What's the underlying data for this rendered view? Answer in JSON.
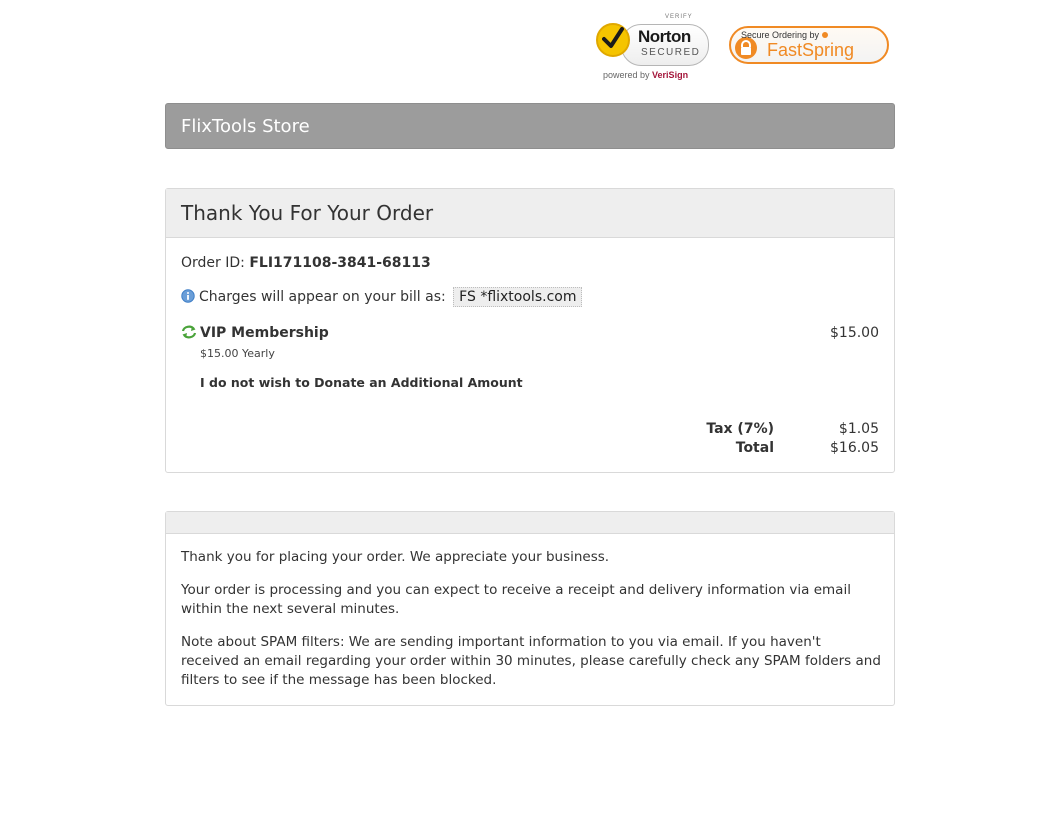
{
  "badges": {
    "norton": {
      "verify": "VERIFY",
      "brand": "Norton",
      "secured": "SECURED",
      "powered_prefix": "powered by",
      "powered_brand": "VeriSign"
    },
    "fastspring": {
      "line1": "Secure Ordering by",
      "line2": "FastSpring"
    }
  },
  "store": {
    "title": "FlixTools Store"
  },
  "order": {
    "heading": "Thank You For Your Order",
    "order_id_label": "Order ID:",
    "order_id": "FLI171108-3841-68113",
    "bill_label": "Charges will appear on your bill as:",
    "bill_descriptor": "FS *flixtools.com",
    "item": {
      "name": "VIP Membership",
      "subscription": "$15.00 Yearly",
      "price": "$15.00",
      "option": "I do not wish to Donate an Additional Amount"
    },
    "tax_label": "Tax (7%)",
    "tax": "$1.05",
    "total_label": "Total",
    "total": "$16.05"
  },
  "message": {
    "p1": "Thank you for placing your order. We appreciate your business.",
    "p2": "Your order is processing and you can expect to receive a receipt and delivery information via email within the next several minutes.",
    "p3": "Note about SPAM filters: We are sending important information to you via email. If you haven't received an email regarding your order within 30 minutes, please carefully check any SPAM folders and filters to see if the message has been blocked."
  },
  "colors": {
    "store_bar": "#9c9c9c",
    "panel_head": "#eeeeee",
    "fastspring_orange": "#f08a24",
    "norton_yellow": "#f5c400",
    "info_blue": "#3f7fc7",
    "renew_green": "#4aa33a"
  }
}
